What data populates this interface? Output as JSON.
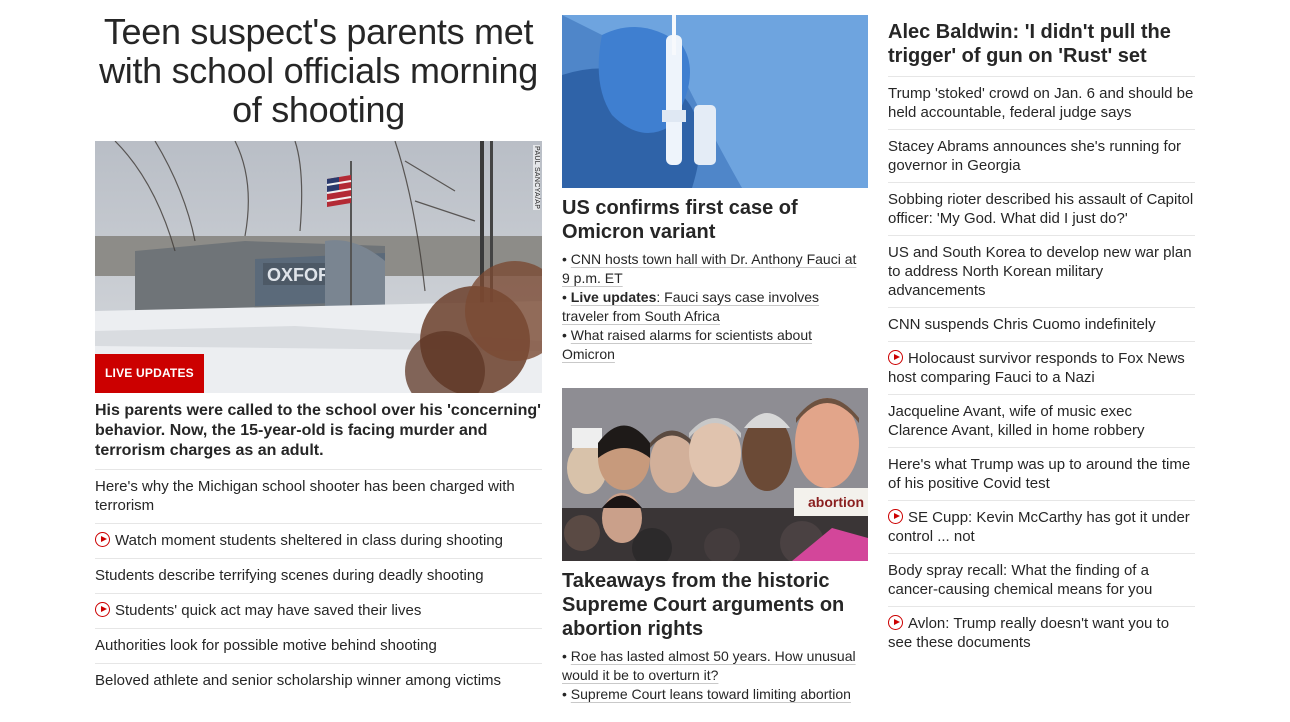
{
  "lead": {
    "headline": "Teen suspect's parents met with school officials morning of shooting",
    "image_credit": "PAUL SANCYA/AP",
    "badge": "LIVE UPDATES",
    "subhead": "His parents were called to the school over his 'concerning' behavior. Now, the 15-year-old is facing murder and terrorism charges as an adult.",
    "related": [
      {
        "text": "Here's why the Michigan school shooter has been charged with terrorism",
        "video": false
      },
      {
        "text": "Watch moment students sheltered in class during shooting",
        "video": true
      },
      {
        "text": "Students describe terrifying scenes during deadly shooting",
        "video": false
      },
      {
        "text": "Students' quick act may have saved their lives",
        "video": true
      },
      {
        "text": "Authorities look for possible motive behind shooting",
        "video": false
      },
      {
        "text": "Beloved athlete and senior scholarship winner among victims",
        "video": false
      }
    ]
  },
  "omicron": {
    "title": "US confirms first case of Omicron variant",
    "bullet1": "CNN hosts town hall with Dr. Anthony Fauci at 9 p.m. ET",
    "bullet2_bold": "Live updates",
    "bullet2_rest": ": Fauci says case involves traveler from South Africa",
    "bullet3": "What raised alarms for scientists about Omicron"
  },
  "court": {
    "sign_text": "abortion",
    "title": "Takeaways from the historic Supreme Court arguments on abortion rights",
    "bullet1": "Roe has lasted almost 50 years. How unusual would it be to overturn it?",
    "bullet2": "Supreme Court leans toward limiting abortion"
  },
  "sidebar": {
    "headline": "Alec Baldwin: 'I didn't pull the trigger' of gun on 'Rust' set",
    "items": [
      {
        "text": "Trump 'stoked' crowd on Jan. 6 and should be held accountable, federal judge says",
        "video": false
      },
      {
        "text": "Stacey Abrams announces she's running for governor in Georgia",
        "video": false
      },
      {
        "text": "Sobbing rioter described his assault of Capitol officer: 'My God. What did I just do?'",
        "video": false
      },
      {
        "text": "US and South Korea to develop new war plan to address North Korean military advancements",
        "video": false
      },
      {
        "text": "CNN suspends Chris Cuomo indefinitely",
        "video": false
      },
      {
        "text": "Holocaust survivor responds to Fox News host comparing Fauci to a Nazi",
        "video": true
      },
      {
        "text": "Jacqueline Avant, wife of music exec Clarence Avant, killed in home robbery",
        "video": false
      },
      {
        "text": "Here's what Trump was up to around the time of his positive Covid test",
        "video": false
      },
      {
        "text": "SE Cupp: Kevin McCarthy has got it under control ... not",
        "video": true
      },
      {
        "text": "Body spray recall: What the finding of a cancer-causing chemical means for you",
        "video": false
      },
      {
        "text": "Avlon: Trump really doesn't want you to see these documents",
        "video": true
      }
    ]
  },
  "colors": {
    "accent_red": "#cc0000",
    "text": "#262626",
    "divider": "#e6e6e6"
  },
  "icons": {
    "video": "play-circle-icon"
  }
}
